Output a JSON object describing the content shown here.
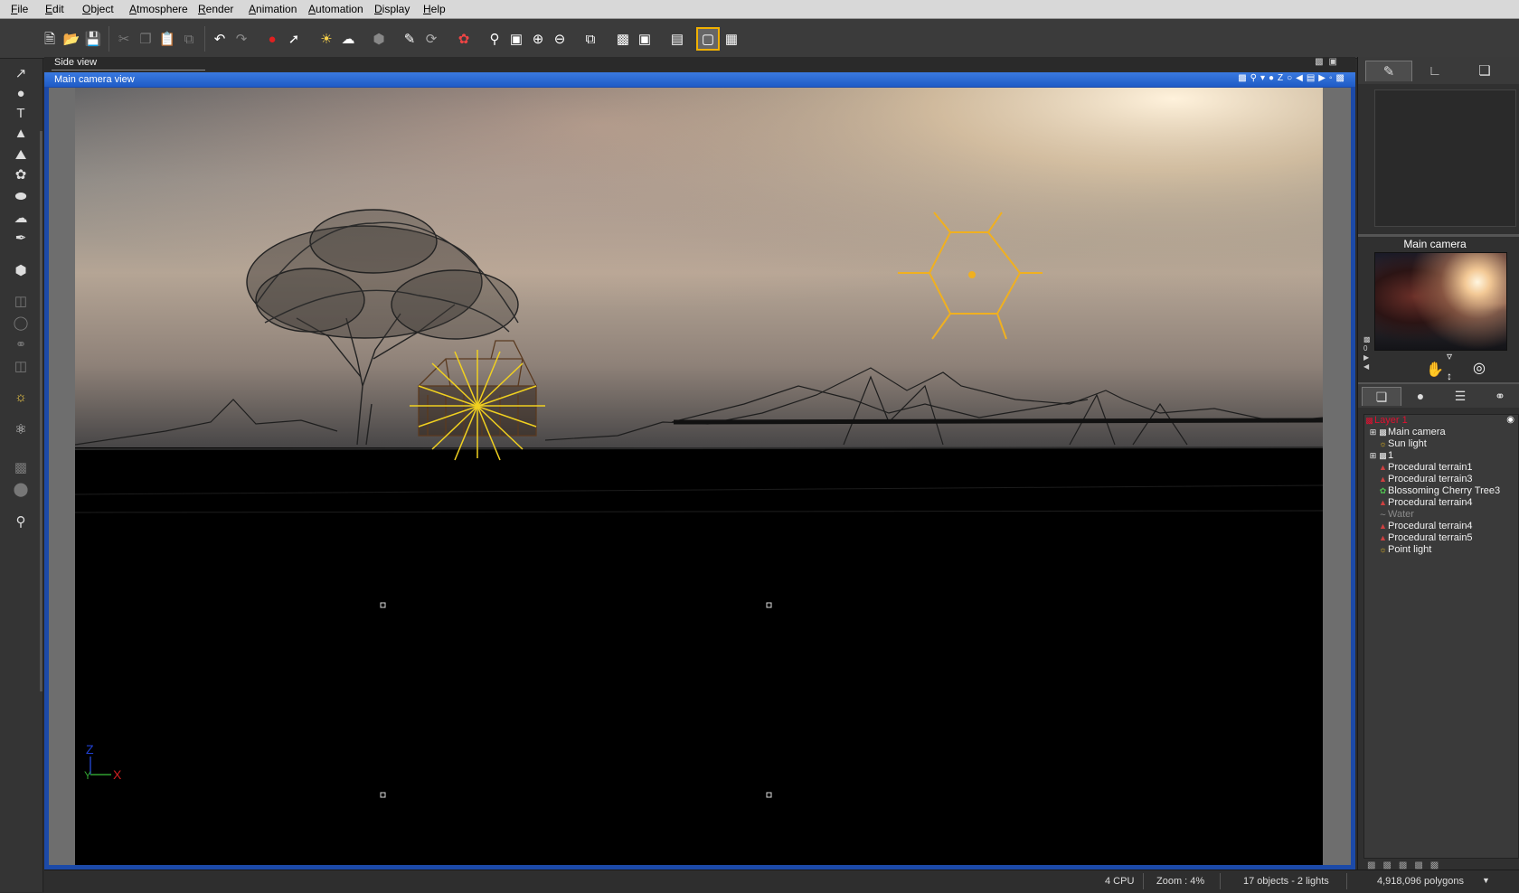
{
  "menubar": {
    "items": [
      "File",
      "Edit",
      "Object",
      "Atmosphere",
      "Render",
      "Animation",
      "Automation",
      "Display",
      "Help"
    ]
  },
  "toolbar": {
    "icons": [
      "new-file-icon",
      "open-file-icon",
      "save-icon",
      "cut-icon",
      "copy-icon",
      "paste-icon",
      "duplicate-icon",
      "undo-icon",
      "redo-icon",
      "select-object-icon",
      "select-tool-icon",
      "sky-icon",
      "clouds-icon",
      "material-icon",
      "edit-object-icon",
      "rotate-icon",
      "color-palette-icon",
      "zoom-object-icon",
      "zoom-region-icon",
      "zoom-in-icon",
      "zoom-out-icon",
      "fit-view-icon",
      "render-area-icon",
      "render-scene-icon",
      "animation-clapper-icon",
      "single-view-icon",
      "multi-view-icon"
    ]
  },
  "left_tools": {
    "icons": [
      "select-arrow-icon",
      "sphere-icon",
      "text-icon",
      "terrain-icon",
      "rocks-icon",
      "plant-icon",
      "egg-icon",
      "cloud-icon",
      "brush-icon",
      "cube-icon",
      "cylinder-icon",
      "torus-icon",
      "boolean-icon",
      "stack-icon",
      "light-icon",
      "molecule-icon",
      "group-icon",
      "metablob-icon",
      "library-icon"
    ]
  },
  "views": {
    "side_view_label": "Side view",
    "main_view_label": "Main camera view"
  },
  "axes": {
    "z": "Z",
    "y": "Y",
    "x": "X"
  },
  "right_panel": {
    "camera_title": "Main camera",
    "tree": [
      {
        "label": "Layer 1",
        "kind": "layer"
      },
      {
        "label": "Main camera",
        "kind": "camera"
      },
      {
        "label": "Sun light",
        "kind": "light"
      },
      {
        "label": "1",
        "kind": "group"
      },
      {
        "label": "Procedural terrain1",
        "kind": "terrain"
      },
      {
        "label": "Procedural terrain3",
        "kind": "terrain"
      },
      {
        "label": "Blossoming Cherry Tree3",
        "kind": "plant"
      },
      {
        "label": "Procedural terrain4",
        "kind": "terrain"
      },
      {
        "label": "Water",
        "kind": "water"
      },
      {
        "label": "Procedural terrain4",
        "kind": "terrain"
      },
      {
        "label": "Procedural terrain5",
        "kind": "terrain"
      },
      {
        "label": "Point light",
        "kind": "light"
      }
    ]
  },
  "status": {
    "cpu": "4 CPU",
    "zoom": "Zoom : 4%",
    "objects": "17 objects - 2 lights",
    "polygons": "4,918,096 polygons"
  },
  "colors": {
    "title_blue": "#1f5bc6",
    "layer_red": "#e01030",
    "sun_yellow": "#f0b020"
  }
}
